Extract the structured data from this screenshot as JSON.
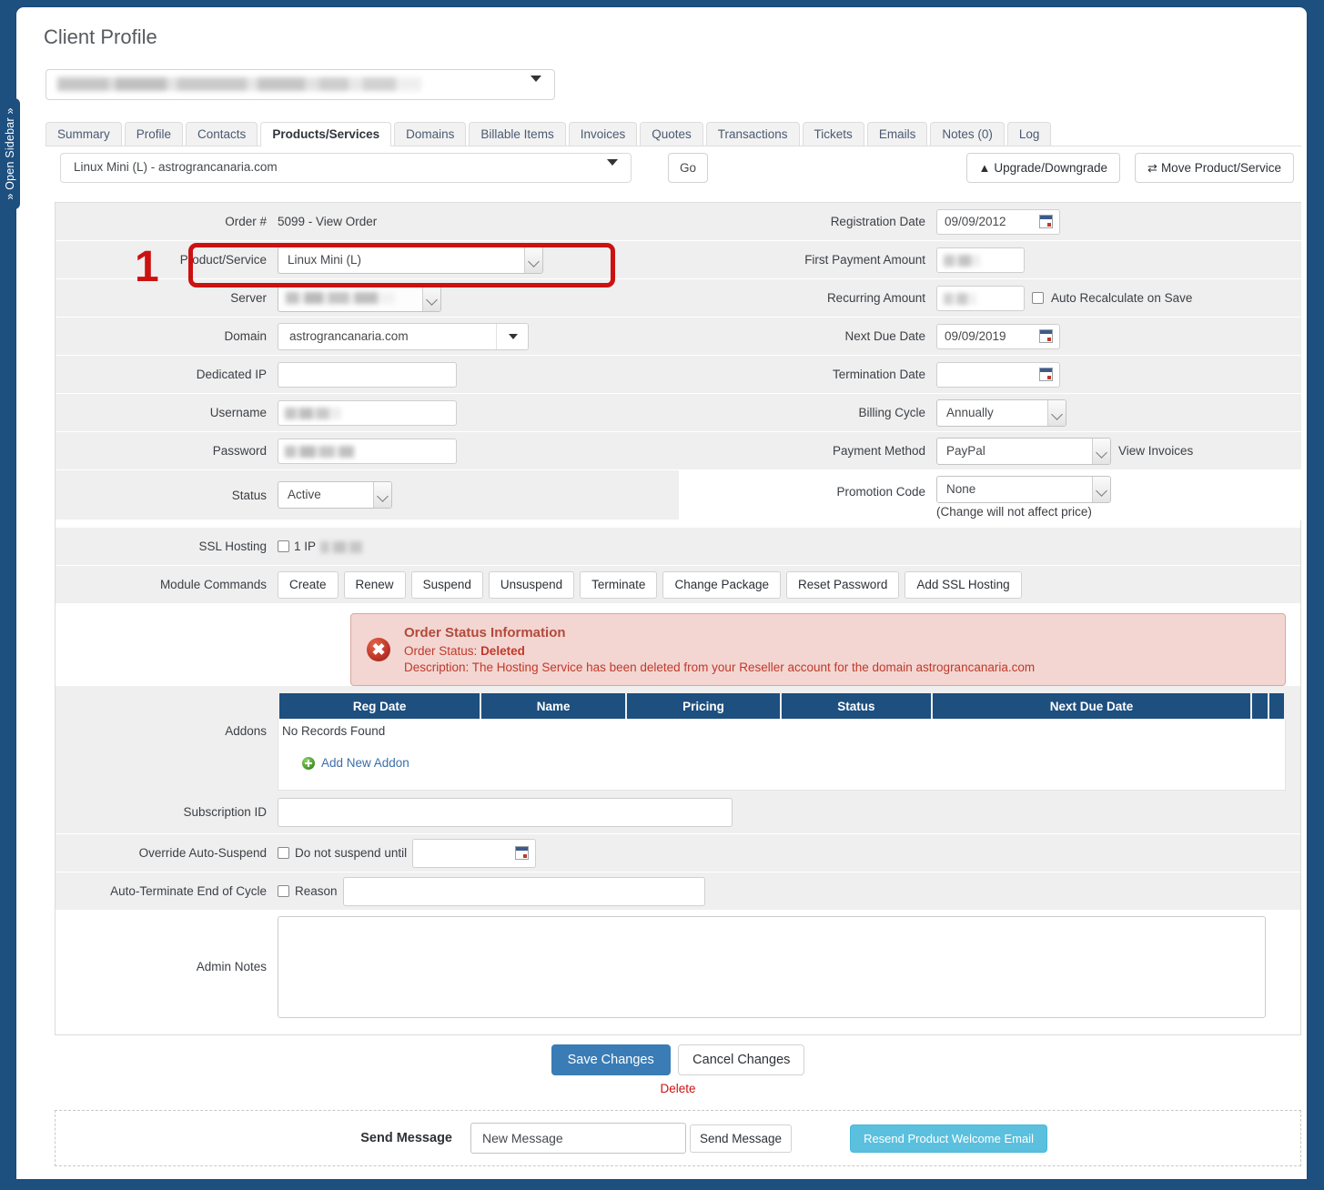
{
  "sidebar": {
    "tab_label": "» Open Sidebar »"
  },
  "header": {
    "title": "Client Profile",
    "client_selector_value": ""
  },
  "tabs": [
    {
      "label": "Summary",
      "active": false
    },
    {
      "label": "Profile",
      "active": false
    },
    {
      "label": "Contacts",
      "active": false
    },
    {
      "label": "Products/Services",
      "active": true
    },
    {
      "label": "Domains",
      "active": false
    },
    {
      "label": "Billable Items",
      "active": false
    },
    {
      "label": "Invoices",
      "active": false
    },
    {
      "label": "Quotes",
      "active": false
    },
    {
      "label": "Transactions",
      "active": false
    },
    {
      "label": "Tickets",
      "active": false
    },
    {
      "label": "Emails",
      "active": false
    },
    {
      "label": "Notes (0)",
      "active": false
    },
    {
      "label": "Log",
      "active": false
    }
  ],
  "toolbar": {
    "product_selector_value": "Linux Mini (L) - astrograncanaria.com",
    "go_label": "Go",
    "upgrade_label": "Upgrade/Downgrade",
    "upgrade_icon": "arrow-up-circle-icon",
    "move_label": "Move Product/Service",
    "move_icon": "shuffle-icon"
  },
  "form_left": {
    "order_label": "Order #",
    "order_value": "5099 - View Order",
    "product_label": "Product/Service",
    "product_value": "Linux Mini (L)",
    "server_label": "Server",
    "server_value": "",
    "domain_label": "Domain",
    "domain_value": "astrograncanaria.com",
    "dedicated_ip_label": "Dedicated IP",
    "dedicated_ip_value": "",
    "username_label": "Username",
    "username_value": "",
    "password_label": "Password",
    "password_value": "",
    "status_label": "Status",
    "status_value": "Active"
  },
  "form_right": {
    "registration_date_label": "Registration Date",
    "registration_date_value": "09/09/2012",
    "first_payment_label": "First Payment Amount",
    "first_payment_value": "",
    "recurring_label": "Recurring Amount",
    "recurring_value": "",
    "auto_recalc_label": "Auto Recalculate on Save",
    "next_due_label": "Next Due Date",
    "next_due_value": "09/09/2019",
    "termination_label": "Termination Date",
    "termination_value": "",
    "billing_cycle_label": "Billing Cycle",
    "billing_cycle_value": "Annually",
    "payment_method_label": "Payment Method",
    "payment_method_value": "PayPal",
    "view_invoices_label": "View Invoices",
    "promotion_label": "Promotion Code",
    "promotion_value": "None",
    "promotion_note": "(Change will not affect price)"
  },
  "ssl_hosting": {
    "label": "SSL Hosting",
    "option_text": "1 IP"
  },
  "module_commands": {
    "label": "Module Commands",
    "buttons": [
      "Create",
      "Renew",
      "Suspend",
      "Unsuspend",
      "Terminate",
      "Change Package",
      "Reset Password",
      "Add SSL Hosting"
    ]
  },
  "order_status_alert": {
    "title": "Order Status Information",
    "status_label": "Order Status:",
    "status_value": "Deleted",
    "description": "Description: The Hosting Service has been deleted from your Reseller account for the domain astrograncanaria.com",
    "icon": "error-x-icon",
    "bg_color": "#f3d6d2",
    "text_color": "#c0392b"
  },
  "addons": {
    "label": "Addons",
    "columns": [
      "Reg Date",
      "Name",
      "Pricing",
      "Status",
      "Next Due Date",
      "",
      ""
    ],
    "empty_text": "No Records Found",
    "add_label": "Add New Addon",
    "add_icon": "plus-circle-icon",
    "header_color": "#1d4f7f"
  },
  "bottom_fields": {
    "subscription_label": "Subscription ID",
    "subscription_value": "",
    "override_label": "Override Auto-Suspend",
    "override_checkbox_label": "Do not suspend until",
    "override_date_value": "",
    "autoterm_label": "Auto-Terminate End of Cycle",
    "autoterm_checkbox_label": "Reason",
    "autoterm_reason_value": "",
    "admin_notes_label": "Admin Notes",
    "admin_notes_value": ""
  },
  "footer": {
    "save_label": "Save Changes",
    "cancel_label": "Cancel Changes",
    "delete_label": "Delete",
    "save_color": "#3a7cb5",
    "delete_color": "#cc1111"
  },
  "send_message": {
    "section_label": "Send Message",
    "select_value": "New Message",
    "send_button_label": "Send Message",
    "resend_button_label": "Resend Product Welcome Email",
    "resend_color": "#5bc0de"
  },
  "annotation": {
    "number": "1",
    "color": "#cc1111"
  }
}
